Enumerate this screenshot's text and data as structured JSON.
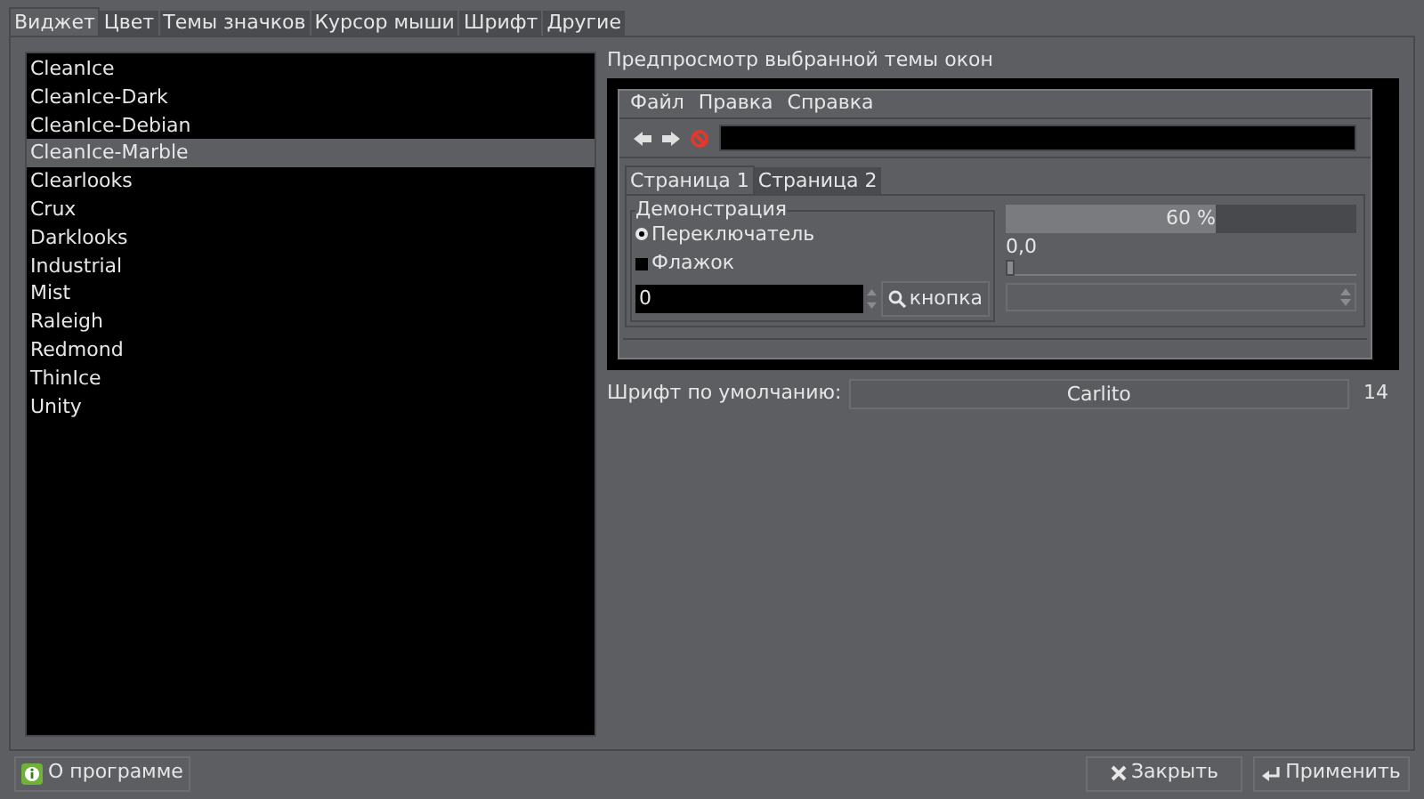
{
  "tabs": [
    {
      "label": "Виджет",
      "selected": true
    },
    {
      "label": "Цвет",
      "selected": false
    },
    {
      "label": "Темы значков",
      "selected": false
    },
    {
      "label": "Курсор мыши",
      "selected": false
    },
    {
      "label": "Шрифт",
      "selected": false
    },
    {
      "label": "Другие",
      "selected": false
    }
  ],
  "theme_list": [
    {
      "label": "CleanIce",
      "selected": false
    },
    {
      "label": "CleanIce-Dark",
      "selected": false
    },
    {
      "label": "CleanIce-Debian",
      "selected": false
    },
    {
      "label": "CleanIce-Marble",
      "selected": true
    },
    {
      "label": "Clearlooks",
      "selected": false
    },
    {
      "label": "Crux",
      "selected": false
    },
    {
      "label": "Darklooks",
      "selected": false
    },
    {
      "label": "Industrial",
      "selected": false
    },
    {
      "label": "Mist",
      "selected": false
    },
    {
      "label": "Raleigh",
      "selected": false
    },
    {
      "label": "Redmond",
      "selected": false
    },
    {
      "label": "ThinIce",
      "selected": false
    },
    {
      "label": "Unity",
      "selected": false
    }
  ],
  "preview": {
    "title": "Предпросмотр выбранной темы окон",
    "menu": [
      "Файл",
      "Правка",
      "Справка"
    ],
    "tabs": [
      {
        "label": "Страница 1",
        "selected": true
      },
      {
        "label": "Страница 2",
        "selected": false
      }
    ],
    "group_title": "Демонстрация",
    "radio": {
      "label": "Переключатель",
      "checked": true
    },
    "checkbox": {
      "label": "Флажок",
      "checked": false
    },
    "spin_value": "0",
    "button": "кнопка",
    "progress": {
      "level": 0.6,
      "reading": "60 %"
    },
    "slider": {
      "reading": "0,0",
      "level": 0
    }
  },
  "font": {
    "label": "Шрифт по умолчанию:",
    "name": "Carlito",
    "size": "14"
  },
  "buttons": {
    "about": "О программе",
    "close": "Закрыть",
    "apply": "Применить"
  }
}
